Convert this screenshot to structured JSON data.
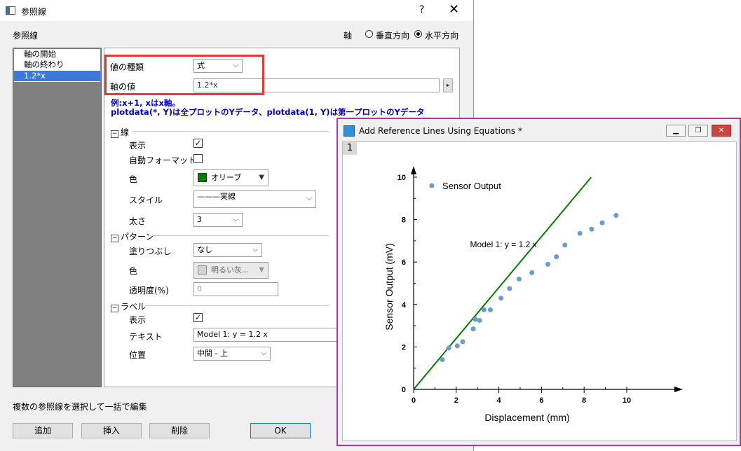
{
  "dialog": {
    "title": "参照線",
    "help_glyph": "?",
    "close_glyph": "✕",
    "section_title": "参照線",
    "axis_label": "軸",
    "radio_vertical": "垂直方向",
    "radio_horizontal": "水平方向",
    "list_items": [
      "軸の開始",
      "軸の終わり",
      "1.2*x"
    ],
    "value_type_label": "値の種類",
    "value_type": "式",
    "axis_value_label": "軸の値",
    "axis_value": "1.2*x",
    "hint_line1": "例:x+1, xはx軸。",
    "hint_line2": "plotdata(*, Y)は全プロットのYデータ、plotdata(1, Y)は第一プロットのYデータ",
    "line_group": "線",
    "show_label": "表示",
    "auto_format_label": "自動フォーマット",
    "color_label": "色",
    "color_value": "オリーブ",
    "style_label": "スタイル",
    "style_value": "———実線",
    "width_label": "太さ",
    "width_value": "3",
    "pattern_group": "パターン",
    "fill_label": "塗りつぶし",
    "fill_value": "なし",
    "pattern_color_label": "色",
    "pattern_color_value": "明るい灰...",
    "transparency_label": "透明度(%)",
    "transparency_value": "0",
    "label_group": "ラベル",
    "label_show_label": "表示",
    "text_label": "テキスト",
    "text_value": "Model 1: y = 1.2 x",
    "position_label": "位置",
    "position_value": "中間 - 上",
    "edit_note": "複数の参照線を選択して一括で編集",
    "btn_add": "追加",
    "btn_insert": "挿入",
    "btn_delete": "削除",
    "btn_ok": "OK",
    "colors": {
      "olive": "#008000",
      "light_gray": "#d3d3d3",
      "selection": "#3c78d7"
    }
  },
  "graph_window": {
    "title": "Add Reference Lines Using Equations *",
    "layer_tab": "1",
    "btn_minimize": "▁",
    "btn_restore": "❐",
    "btn_close": "✕"
  },
  "chart_data": {
    "type": "scatter",
    "xlabel": "Displacement (mm)",
    "ylabel": "Sensor Output (mV)",
    "xlim": [
      0,
      10
    ],
    "ylim": [
      0,
      10
    ],
    "xticks": [
      0,
      2,
      4,
      6,
      8,
      10
    ],
    "yticks": [
      0,
      2,
      4,
      6,
      8,
      10
    ],
    "grid": false,
    "legend": "top-left",
    "series": [
      {
        "name": "Sensor Output",
        "color": "#6a9bd1",
        "x": [
          1.35,
          1.65,
          2.05,
          2.3,
          2.8,
          2.9,
          3.1,
          3.3,
          3.6,
          4.1,
          4.5,
          4.95,
          5.55,
          6.3,
          6.7,
          7.1,
          7.8,
          8.35,
          8.85,
          9.5
        ],
        "y": [
          1.4,
          1.95,
          2.05,
          2.25,
          2.85,
          3.3,
          3.25,
          3.75,
          3.75,
          4.3,
          4.75,
          5.2,
          5.5,
          5.9,
          6.25,
          6.8,
          7.35,
          7.55,
          7.85,
          8.2
        ]
      }
    ],
    "reference_line": {
      "label": "Model 1: y = 1.2 x",
      "slope": 1.2,
      "color": "#008000",
      "x_range": [
        0,
        8.33
      ]
    }
  }
}
